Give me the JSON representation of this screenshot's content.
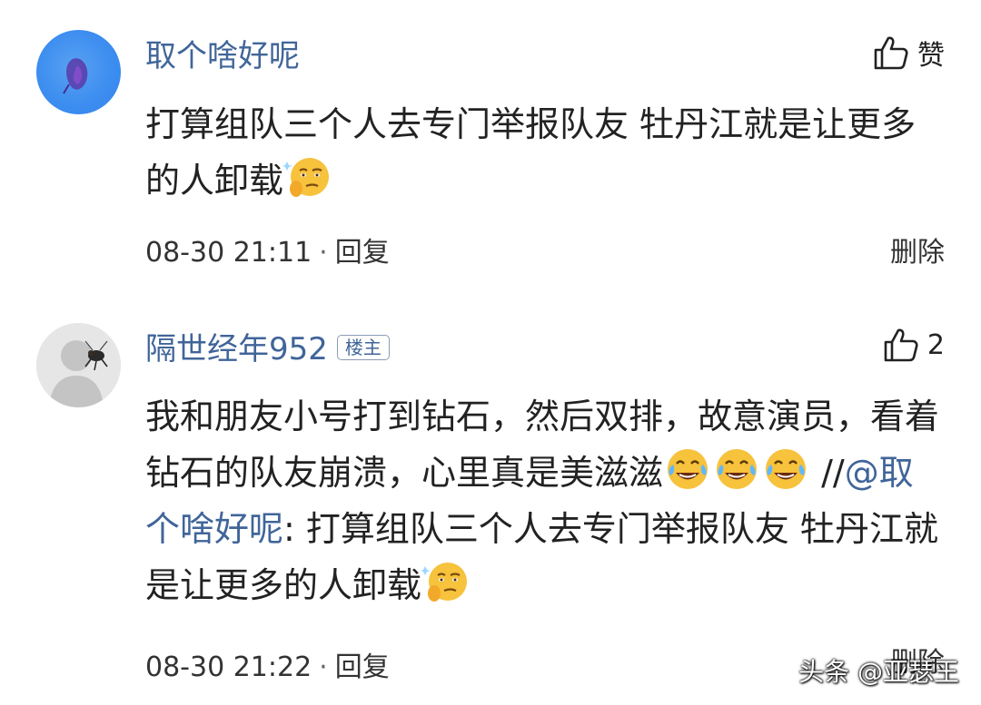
{
  "comments": [
    {
      "username": "取个啥好呢",
      "like_label": "赞",
      "text": "打算组队三个人去专门举报队友 牡丹江就是让更多的人卸载",
      "emoji": "smirk-emoji",
      "time": "08-30 21:11",
      "separator": "·",
      "reply_label": "回复",
      "delete_label": "删除"
    },
    {
      "username": "隔世经年952",
      "badge": "楼主",
      "like_count": "2",
      "text_part1": "我和朋友小号打到钻石，然后双排，故意演员，看着钻石的队友崩溃，心里真是美滋滋",
      "emojis": [
        "crying-laugh-emoji",
        "crying-laugh-emoji",
        "crying-laugh-emoji"
      ],
      "repost_prefix": "//",
      "mention": "@取个啥好呢",
      "text_part2": ": 打算组队三个人去专门举报队友 牡丹江就是让更多的人卸载",
      "time": "08-30 21:22",
      "separator": "·",
      "reply_label": "回复",
      "delete_label": "删除"
    }
  ],
  "watermark": "头条 @亚瑟王",
  "colors": {
    "username": "#406599",
    "text": "#222222",
    "avatar_blue": "#3d8ef0"
  }
}
